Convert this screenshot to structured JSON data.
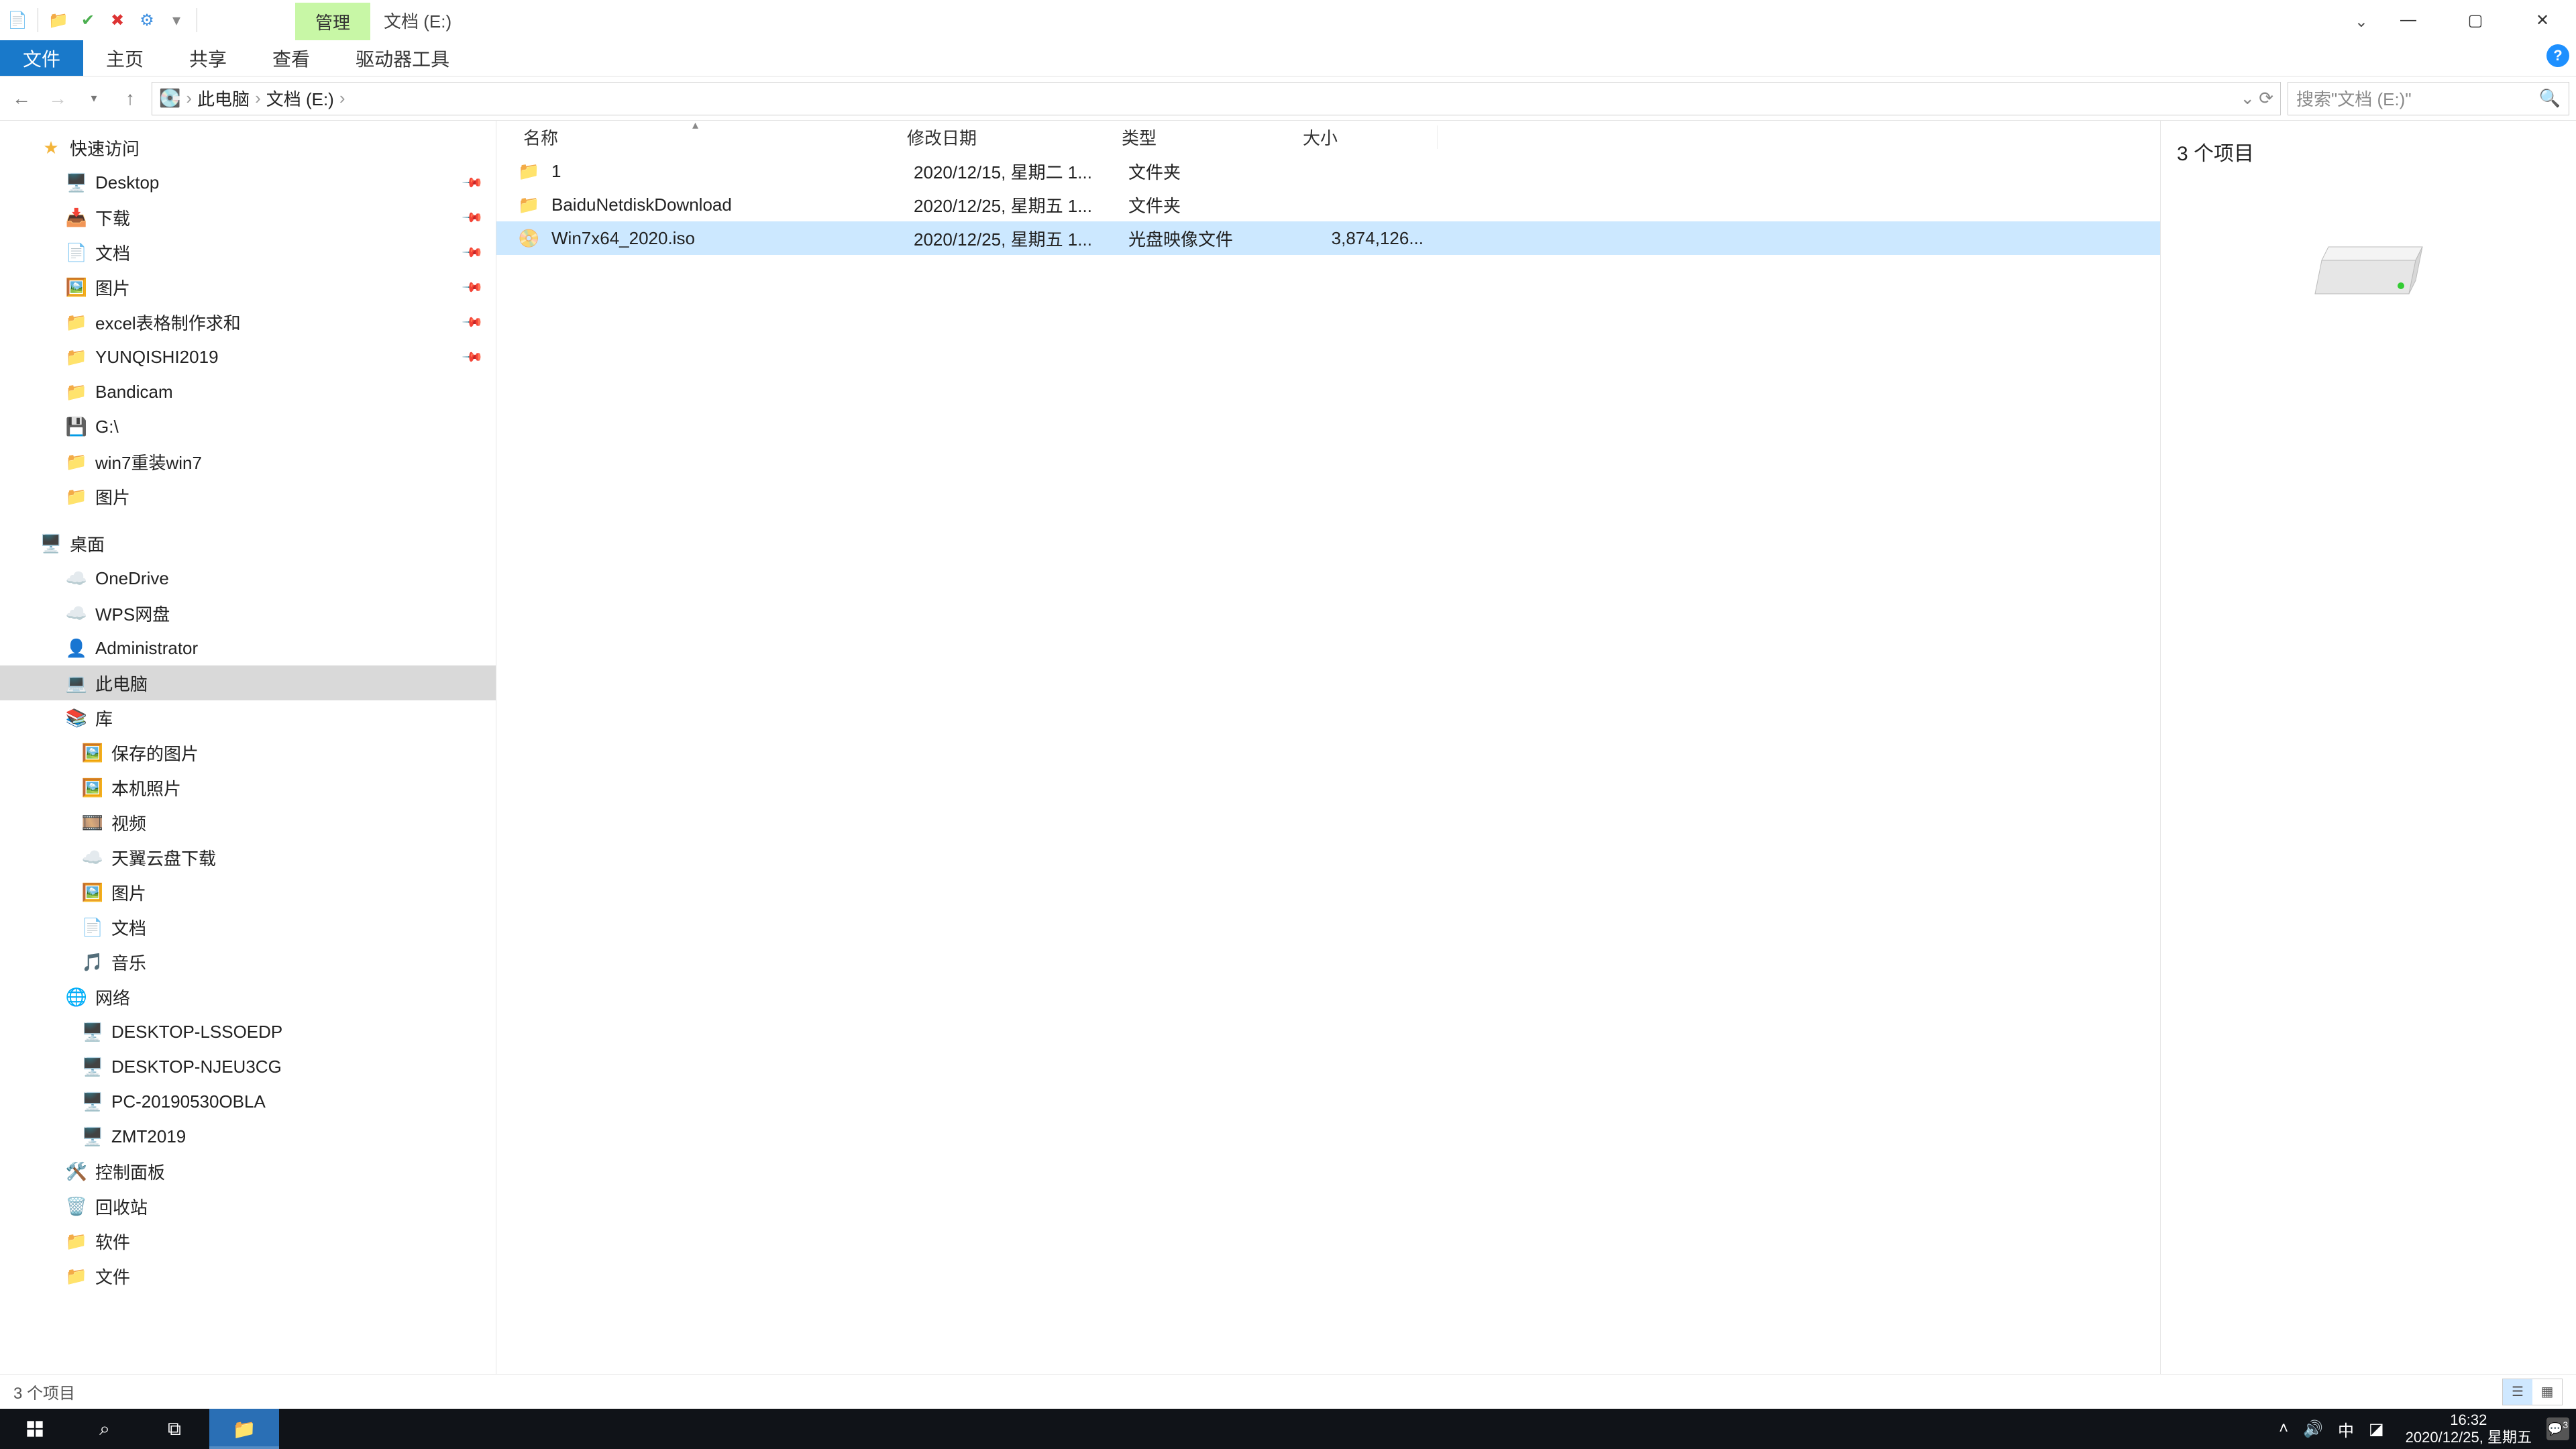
{
  "title": {
    "context_tab": "管理",
    "location": "文档 (E:)"
  },
  "ribbon": {
    "file": "文件",
    "home": "主页",
    "share": "共享",
    "view": "查看",
    "drive_tools": "驱动器工具"
  },
  "addr": {
    "root": "此电脑",
    "location": "文档 (E:)"
  },
  "search": {
    "placeholder": "搜索\"文档 (E:)\""
  },
  "tree": {
    "quick_access": "快速访问",
    "qa_items": [
      {
        "label": "Desktop",
        "icon": "🖥️",
        "pinned": true
      },
      {
        "label": "下载",
        "icon": "📥",
        "pinned": true
      },
      {
        "label": "文档",
        "icon": "📄",
        "pinned": true
      },
      {
        "label": "图片",
        "icon": "🖼️",
        "pinned": true
      },
      {
        "label": "excel表格制作求和",
        "icon": "📁",
        "pinned": true
      },
      {
        "label": "YUNQISHI2019",
        "icon": "📁",
        "pinned": true
      },
      {
        "label": "Bandicam",
        "icon": "📁",
        "pinned": false
      },
      {
        "label": "G:\\",
        "icon": "💾",
        "pinned": false
      },
      {
        "label": "win7重装win7",
        "icon": "📁",
        "pinned": false
      },
      {
        "label": "图片",
        "icon": "📁",
        "pinned": false
      }
    ],
    "desktop": "桌面",
    "desktop_items": [
      {
        "label": "OneDrive",
        "icon": "☁️"
      },
      {
        "label": "WPS网盘",
        "icon": "☁️"
      },
      {
        "label": "Administrator",
        "icon": "👤"
      },
      {
        "label": "此电脑",
        "icon": "💻",
        "selected": true
      },
      {
        "label": "库",
        "icon": "📚"
      }
    ],
    "library_items": [
      {
        "label": "保存的图片",
        "icon": "🖼️"
      },
      {
        "label": "本机照片",
        "icon": "🖼️"
      },
      {
        "label": "视频",
        "icon": "🎞️"
      },
      {
        "label": "天翼云盘下载",
        "icon": "☁️"
      },
      {
        "label": "图片",
        "icon": "🖼️"
      },
      {
        "label": "文档",
        "icon": "📄"
      },
      {
        "label": "音乐",
        "icon": "🎵"
      }
    ],
    "network": "网络",
    "network_items": [
      {
        "label": "DESKTOP-LSSOEDP",
        "icon": "🖥️"
      },
      {
        "label": "DESKTOP-NJEU3CG",
        "icon": "🖥️"
      },
      {
        "label": "PC-20190530OBLA",
        "icon": "🖥️"
      },
      {
        "label": "ZMT2019",
        "icon": "🖥️"
      }
    ],
    "control_panel": "控制面板",
    "recycle": "回收站",
    "software": "软件",
    "files": "文件"
  },
  "columns": {
    "name": "名称",
    "date": "修改日期",
    "type": "类型",
    "size": "大小"
  },
  "rows": [
    {
      "icon": "📁",
      "name": "1",
      "date": "2020/12/15, 星期二 1...",
      "type": "文件夹",
      "size": ""
    },
    {
      "icon": "📁",
      "name": "BaiduNetdiskDownload",
      "date": "2020/12/25, 星期五 1...",
      "type": "文件夹",
      "size": ""
    },
    {
      "icon": "📀",
      "name": "Win7x64_2020.iso",
      "date": "2020/12/25, 星期五 1...",
      "type": "光盘映像文件",
      "size": "3,874,126...",
      "selected": true
    }
  ],
  "preview": {
    "count_label": "3 个项目"
  },
  "status": {
    "count": "3 个项目"
  },
  "taskbar": {
    "time": "16:32",
    "date": "2020/12/25, 星期五",
    "ime": "中",
    "notif_count": "3"
  }
}
